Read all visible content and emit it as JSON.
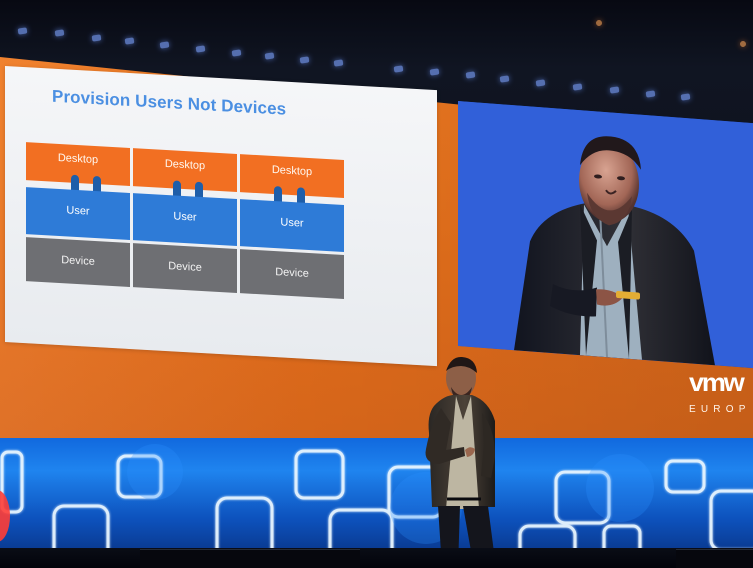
{
  "slide": {
    "title": "Provision Users Not Devices",
    "columns": [
      {
        "desktop": "Desktop",
        "user": "User",
        "device": "Device"
      },
      {
        "desktop": "Desktop",
        "user": "User",
        "device": "Device"
      },
      {
        "desktop": "Desktop",
        "user": "User",
        "device": "Device"
      }
    ]
  },
  "brand": {
    "logo_text": "vmw",
    "subtitle": "EUROP"
  },
  "colors": {
    "stage_orange": "#ef7a22",
    "slide_title_blue": "#4b8fe2",
    "desktop_orange": "#f26f22",
    "user_blue": "#2e7bd7",
    "device_gray": "#6e6f73",
    "screen_blue": "#2c61df"
  },
  "visual_elements": {
    "icons": [
      "presenter-figure",
      "video-presenter-figure",
      "decorative-square-outline",
      "stage-light"
    ]
  }
}
